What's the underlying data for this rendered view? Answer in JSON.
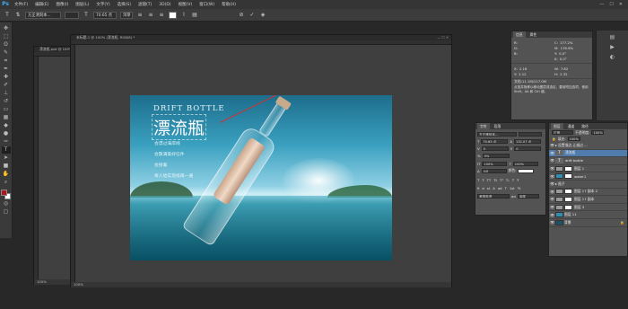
{
  "menubar": {
    "logo": "Ps",
    "items": [
      "文件(F)",
      "编辑(E)",
      "图像(I)",
      "图层(L)",
      "文字(Y)",
      "选择(S)",
      "滤镜(T)",
      "3D(D)",
      "视图(V)",
      "窗口(W)",
      "帮助(H)"
    ],
    "controls": [
      "—",
      "☐",
      "✕"
    ]
  },
  "optionsbar": {
    "font_family": "方正清刻本...",
    "font_size": "70.65 点",
    "antialias": "浑厚",
    "cancel": "⊘",
    "commit": "✓"
  },
  "doc_small": {
    "title": "漂流瓶.psd @ 100%...",
    "zoom": "100%"
  },
  "doc_main": {
    "title": "未标题-1 @ 100% (漂流瓶, RGB/8) *",
    "zoom": "100%"
  },
  "artwork": {
    "headline_en": "DRIFT BOTTLE",
    "headline_cn": "漂流瓶",
    "lines": [
      "会漂过海岸线",
      "会飘满美好信件",
      "会接着",
      "寄人给实现纸再一遍"
    ]
  },
  "info_panel": {
    "tabs": [
      "信息",
      "属性"
    ],
    "rgb": {
      "r": "R:",
      "g": "G:",
      "b": "B:",
      "r_val": "",
      "g_val": "",
      "b_val": ""
    },
    "cmyk": {
      "c": "C:",
      "m": "M:",
      "y": "Y:",
      "k": "K:",
      "c_val": "177.2%",
      "m_val": "176.9%",
      "y_val": "0.0°",
      "k_val": "0.0°"
    },
    "xy": {
      "x": "X:",
      "y": "Y:",
      "x_val": "2.16",
      "y_val": "2.12"
    },
    "wh": {
      "w": "W:",
      "h": "H:",
      "w_val": "7.82",
      "h_val": "2.32"
    },
    "doc_size": "文档:11.1M/117.0M",
    "hint": "点按并拖移以移动图层或选区，要用附加选项，使用 Shift、Alt 和 Ctrl 键。"
  },
  "char_panel": {
    "tabs": [
      "字符",
      "段落"
    ],
    "font": "方正清刻本...",
    "size": "70.65 点",
    "leading": "132.07 点",
    "kerning": "0",
    "tracking": "0",
    "scale_v": "100%",
    "scale_h": "100%",
    "baseline": "0点",
    "color_label": "颜色:",
    "language": "美国英语",
    "aa": "浑厚"
  },
  "layers_panel": {
    "tabs": [
      "图层",
      "通道",
      "路径"
    ],
    "filter": "正常",
    "opacity_label": "不透明度:",
    "opacity": "100%",
    "fill_label": "填充:",
    "fill": "100%",
    "layers": [
      {
        "name": "设置描边,让描边 ...",
        "kind": "group"
      },
      {
        "name": "漂流瓶",
        "kind": "text",
        "selected": true
      },
      {
        "name": "drift bottle",
        "kind": "text"
      },
      {
        "name": "图层 1",
        "kind": "image"
      },
      {
        "name": "water1",
        "kind": "image"
      },
      {
        "name": "瓶子",
        "kind": "group"
      },
      {
        "name": "图层 17 副本 2",
        "kind": "image"
      },
      {
        "name": "图层 17 副本",
        "kind": "image"
      },
      {
        "name": "图层 3",
        "kind": "image"
      },
      {
        "name": "图层 11",
        "kind": "image"
      },
      {
        "name": "背景",
        "kind": "background"
      }
    ]
  }
}
